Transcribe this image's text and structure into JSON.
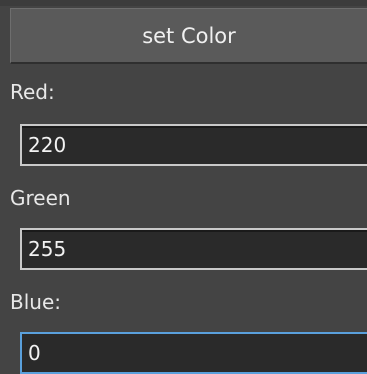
{
  "panel": {
    "button_label": "set Color",
    "fields": [
      {
        "label": "Red:",
        "value": "220"
      },
      {
        "label": "Green",
        "value": "255"
      },
      {
        "label": "Blue:",
        "value": "0"
      }
    ]
  },
  "colors": {
    "background": "#444444",
    "button": "#5a5a5a",
    "input_background": "#2a2a2a",
    "input_border": "#c9c9c9",
    "focus_border": "#5aa0dc"
  }
}
